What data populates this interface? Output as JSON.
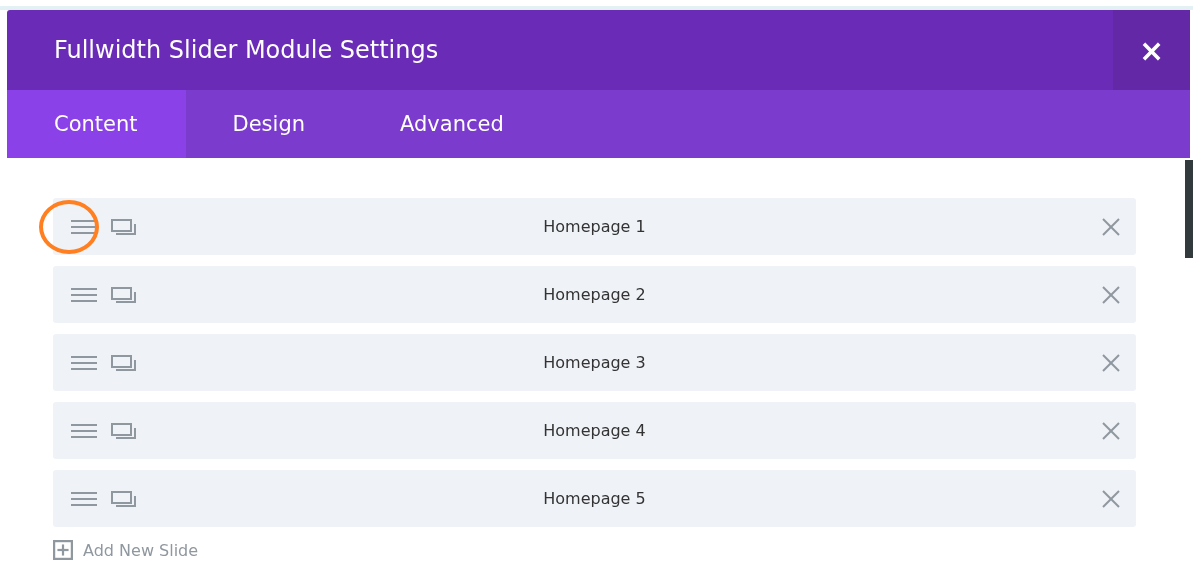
{
  "dialog": {
    "title": "Fullwidth Slider Module Settings",
    "close": "×"
  },
  "tabs": [
    {
      "label": "Content",
      "selected": true
    },
    {
      "label": "Design",
      "selected": false
    },
    {
      "label": "Advanced",
      "selected": false
    }
  ],
  "slides": [
    {
      "label": "Homepage 1",
      "highlighted": true
    },
    {
      "label": "Homepage 2",
      "highlighted": false
    },
    {
      "label": "Homepage 3",
      "highlighted": false
    },
    {
      "label": "Homepage 4",
      "highlighted": false
    },
    {
      "label": "Homepage 5",
      "highlighted": false
    }
  ],
  "add_button": {
    "label": "Add New Slide"
  }
}
